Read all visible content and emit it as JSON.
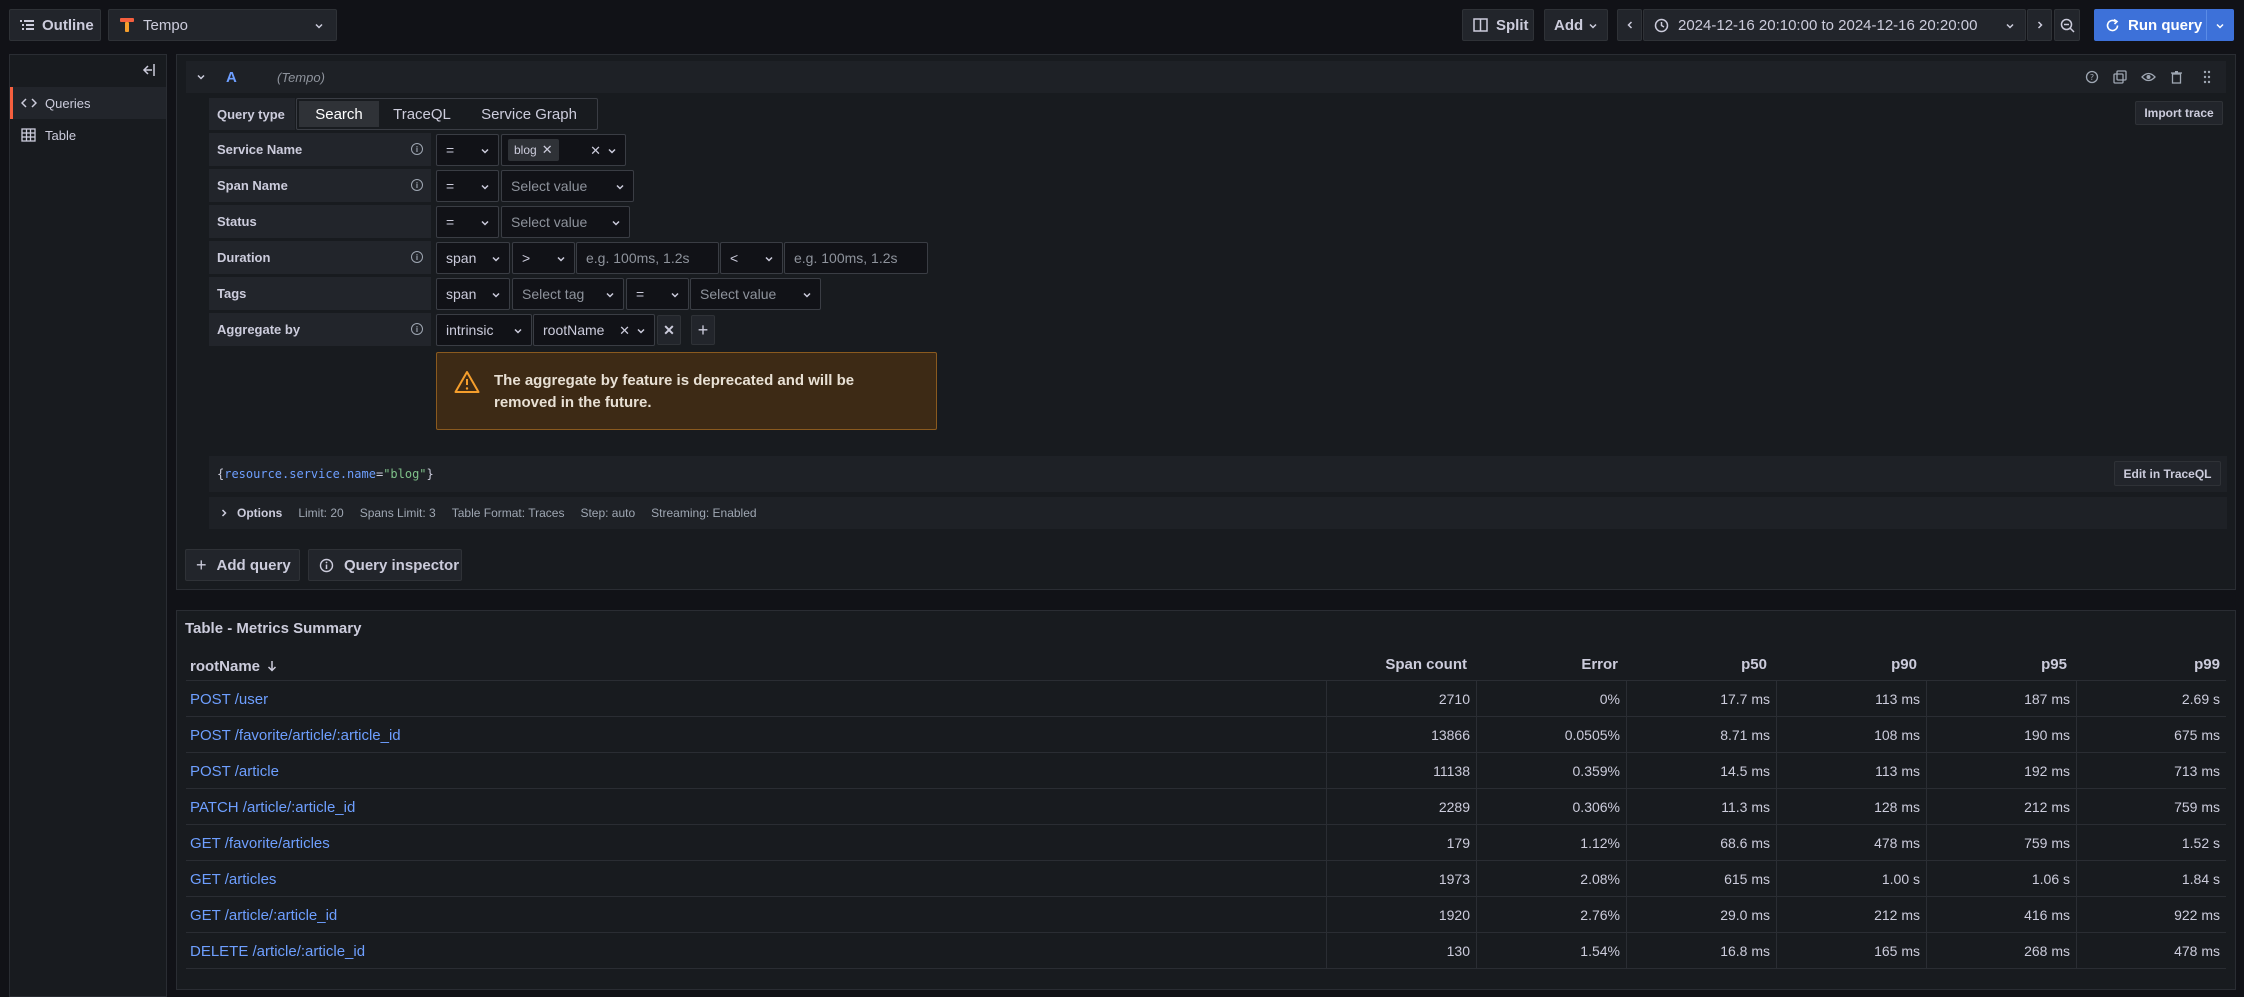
{
  "toolbar": {
    "outline_label": "Outline",
    "datasource": "Tempo",
    "split_label": "Split",
    "add_label": "Add",
    "time_range": "2024-12-16 20:10:00 to 2024-12-16 20:20:00",
    "run_query_label": "Run query"
  },
  "sidebar": {
    "items": [
      {
        "label": "Queries",
        "icon": "code-icon",
        "active": true
      },
      {
        "label": "Table",
        "icon": "table-icon",
        "active": false
      }
    ]
  },
  "query": {
    "ref_id": "A",
    "datasource_hint": "(Tempo)",
    "query_type_label": "Query type",
    "query_types": [
      "Search",
      "TraceQL",
      "Service Graph"
    ],
    "active_query_type": "Search",
    "import_trace_label": "Import trace",
    "fields": {
      "service_name": {
        "label": "Service Name",
        "operator": "=",
        "value": "blog"
      },
      "span_name": {
        "label": "Span Name",
        "operator": "=",
        "placeholder": "Select value"
      },
      "status": {
        "label": "Status",
        "operator": "=",
        "placeholder": "Select value"
      },
      "duration": {
        "label": "Duration",
        "scope": "span",
        "op_min": ">",
        "min_placeholder": "e.g. 100ms, 1.2s",
        "op_max": "<",
        "max_placeholder": "e.g. 100ms, 1.2s"
      },
      "tags": {
        "label": "Tags",
        "scope": "span",
        "tag_placeholder": "Select tag",
        "operator": "=",
        "value_placeholder": "Select value"
      },
      "aggregate_by": {
        "label": "Aggregate by",
        "scope": "intrinsic",
        "value": "rootName"
      }
    },
    "warning": "The aggregate by feature is deprecated and will be removed in the future.",
    "traceql": {
      "open": "{",
      "key": "resource.service.name",
      "op": "=",
      "value": "\"blog\"",
      "close": "}"
    },
    "edit_traceql_label": "Edit in TraceQL",
    "options": {
      "label": "Options",
      "items": [
        "Limit: 20",
        "Spans Limit: 3",
        "Table Format: Traces",
        "Step: auto",
        "Streaming: Enabled"
      ]
    },
    "add_query_label": "Add query",
    "query_inspector_label": "Query inspector"
  },
  "table": {
    "title": "Table - Metrics Summary",
    "columns": [
      "rootName",
      "Span count",
      "Error",
      "p50",
      "p90",
      "p95",
      "p99"
    ],
    "rows": [
      [
        "POST /user",
        "2710",
        "0%",
        "17.7 ms",
        "113 ms",
        "187 ms",
        "2.69 s"
      ],
      [
        "POST /favorite/article/:article_id",
        "13866",
        "0.0505%",
        "8.71 ms",
        "108 ms",
        "190 ms",
        "675 ms"
      ],
      [
        "POST /article",
        "11138",
        "0.359%",
        "14.5 ms",
        "113 ms",
        "192 ms",
        "713 ms"
      ],
      [
        "PATCH /article/:article_id",
        "2289",
        "0.306%",
        "11.3 ms",
        "128 ms",
        "212 ms",
        "759 ms"
      ],
      [
        "GET /favorite/articles",
        "179",
        "1.12%",
        "68.6 ms",
        "478 ms",
        "759 ms",
        "1.52 s"
      ],
      [
        "GET /articles",
        "1973",
        "2.08%",
        "615 ms",
        "1.00 s",
        "1.06 s",
        "1.84 s"
      ],
      [
        "GET /article/:article_id",
        "1920",
        "2.76%",
        "29.0 ms",
        "212 ms",
        "416 ms",
        "922 ms"
      ],
      [
        "DELETE /article/:article_id",
        "130",
        "1.54%",
        "16.8 ms",
        "165 ms",
        "268 ms",
        "478 ms"
      ]
    ]
  },
  "colors": {
    "background": "#111217",
    "panel": "#181b1f",
    "accent": "#3d71d9",
    "link": "#6e9fff",
    "warning_bg": "#3d2a15",
    "warning_border": "#f59e2c",
    "tempo_logo": "#f55f3e"
  }
}
